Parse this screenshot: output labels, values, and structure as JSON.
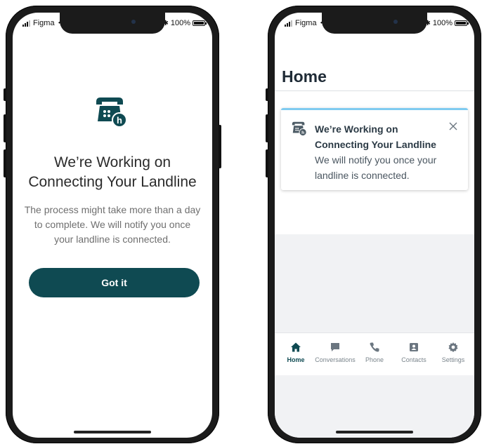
{
  "status_bar": {
    "carrier": "Figma",
    "battery": "100%"
  },
  "left_screen": {
    "title_lines": [
      "We’re Working on",
      "Connecting Your Landline"
    ],
    "body_lines": [
      "The process might take more than a day",
      "to complete. We will notify you once",
      "your landline is connected."
    ],
    "button_label": "Got it",
    "icon": "landline-phone-icon"
  },
  "right_screen": {
    "page_title": "Home",
    "notification": {
      "icon": "landline-phone-icon",
      "title_lines": [
        "We’re Working on",
        "Connecting Your Landline"
      ],
      "body_lines": [
        "We will notify you once your",
        "landline is connected."
      ],
      "close_icon": "close-icon"
    },
    "tabs": [
      {
        "label": "Home",
        "icon": "home-icon",
        "active": true
      },
      {
        "label": "Conversations",
        "icon": "chat-icon",
        "active": false
      },
      {
        "label": "Phone",
        "icon": "phone-icon",
        "active": false
      },
      {
        "label": "Contacts",
        "icon": "contacts-icon",
        "active": false
      },
      {
        "label": "Settings",
        "icon": "gear-icon",
        "active": false
      }
    ]
  },
  "colors": {
    "primary": "#0f4a52",
    "accent": "#7fcbf0",
    "text": "#2b2b2b",
    "muted": "#6f6f6f"
  }
}
